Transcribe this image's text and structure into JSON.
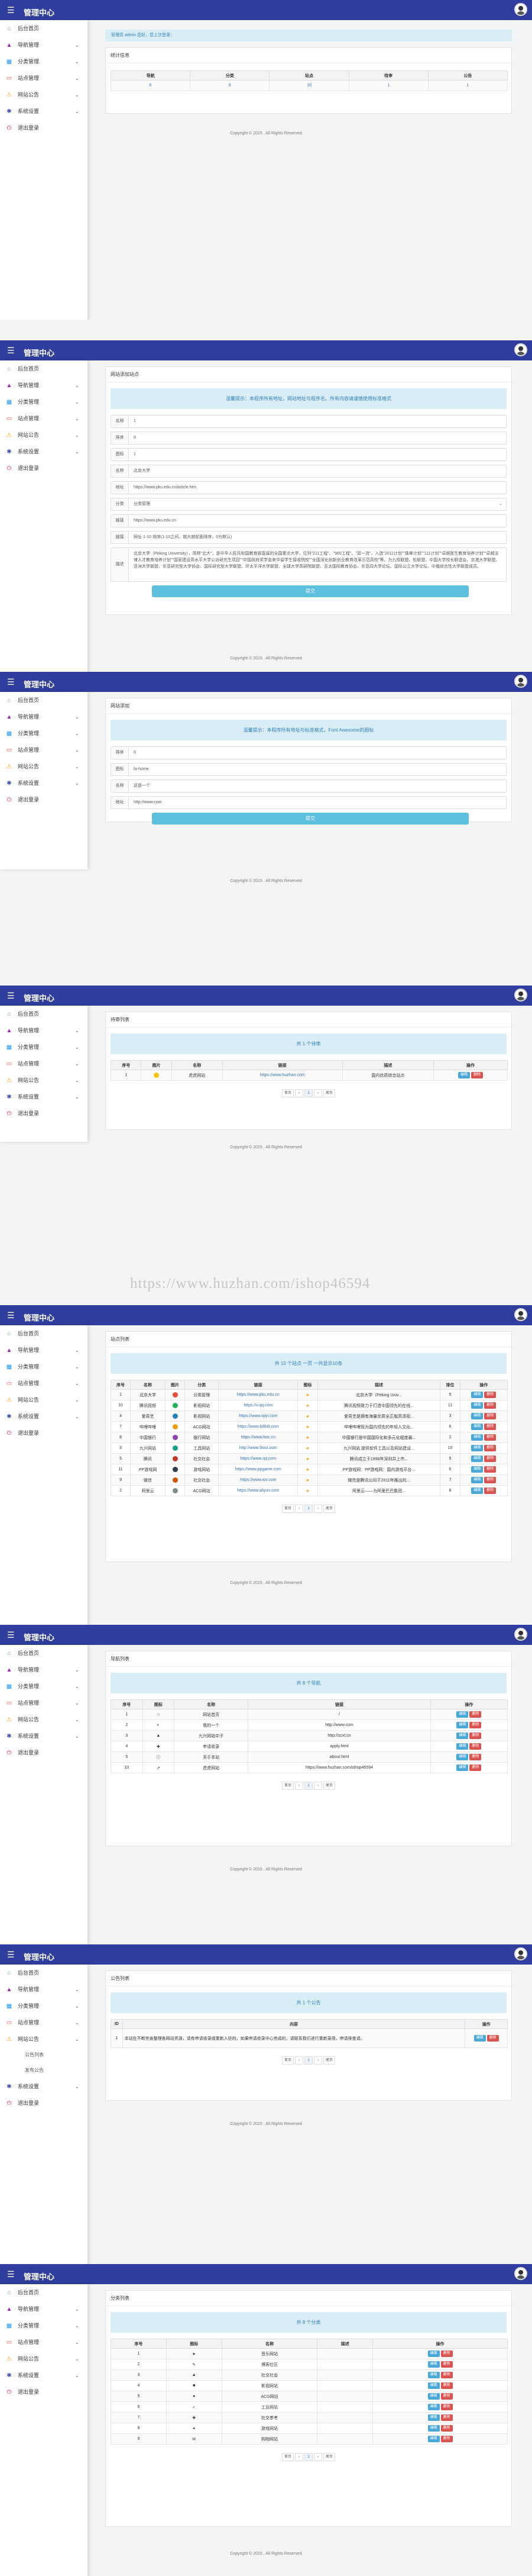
{
  "app": {
    "title": "管理中心",
    "menu_icon": "☰",
    "copyright": "Copyright © 2015 . All Rights Reserved"
  },
  "sidebar_items": [
    {
      "label": "后台首页",
      "icon": "home-icon",
      "color": "#4caf50"
    },
    {
      "label": "导航管理",
      "icon": "triangle-icon",
      "color": "#9c27b0",
      "chevron": "⌄"
    },
    {
      "label": "分类管理",
      "icon": "grid-icon",
      "color": "#2196f3",
      "chevron": "⌄"
    },
    {
      "label": "站点管理",
      "icon": "card-icon",
      "color": "#f44336",
      "chevron": "⌄"
    },
    {
      "label": "网站公告",
      "icon": "warning-icon",
      "color": "#ff9800",
      "chevron": "⌄"
    },
    {
      "label": "系统设置",
      "icon": "gear-icon",
      "color": "#3f51b5",
      "chevron": "⌄"
    },
    {
      "label": "退出登录",
      "icon": "exit-icon",
      "color": "#e91e63"
    }
  ],
  "sidebar_sub": [
    "公告列表",
    "发布公告"
  ],
  "s1": {
    "notice": "管理员 admin 您好，您上次登录：",
    "stats_title": "统计信息",
    "headers": [
      "导航",
      "分类",
      "站点",
      "待审",
      "公告"
    ],
    "values": [
      "6",
      "6",
      "10",
      "1",
      "1"
    ]
  },
  "s2": {
    "title": "网站添加站点",
    "notice": "温馨提示：本程序所有地址，网站地址与程序名。所有内容请谨慎使用标准格式",
    "rows": [
      {
        "label": "名称",
        "value": "1"
      },
      {
        "label": "排序",
        "value": "0"
      },
      {
        "label": "图标",
        "value": "1"
      },
      {
        "label": "名称",
        "value": "北京大学"
      },
      {
        "label": "地址",
        "value": "https://www.pku.edu.cn/article.htm"
      },
      {
        "label": "分类",
        "value": "分类管理",
        "arrow": "⌄"
      },
      {
        "label": "链接",
        "value": "https://www.pku.edu.cn"
      },
      {
        "label": "链接",
        "value": "网址 1-10 排序(1-10之间，越大越前面排序，0为默认)"
      }
    ],
    "description": "北京大学（Peking University），简称\"北大\"，是中华人民共和国教育部直属的全国重点大学，位列\"211工程\"、\"985工程\"、\"双一流\"，入选\"2011计划\"\"珠峰计划\"\"111计划\"\"卓越医生教育培养计划\"\"卓越法律人才教育培养计划\"\"国家建设高水平大学公派研究生项目\"\"中国政府奖学金来华留学生接收院校\"\"全国深化创新创业教育改革示范高校\"等，为九校联盟、松联盟、中国大学校长联谊会、京港大学联盟、亚洲大学联盟、东亚研究型大学协会、国际研究型大学联盟、环太平洋大学联盟、全球大学高研院联盟、亚太国际教育协会、东亚四大学论坛、国际公立大学论坛、中俄综合性大学联盟成员。",
    "submit": "提交"
  },
  "s3": {
    "title": "网站添加",
    "notice": "温馨提示：本程序所有地址与标准格式，Font Awesome的图标",
    "rows": [
      {
        "label": "排序",
        "value": "0"
      },
      {
        "label": "图标",
        "value": "fa-home"
      },
      {
        "label": "名称",
        "value": "这是一个"
      },
      {
        "label": "地址",
        "value": "http://www.com"
      }
    ],
    "submit": "提交"
  },
  "s4": {
    "title": "待审列表",
    "notice": "共 1 个待审",
    "headers": [
      "序号",
      "图片",
      "名称",
      "链接",
      "描述",
      "操作"
    ],
    "rows": [
      [
        "1",
        "",
        "虎虎网站",
        "https://www.huzhan.com",
        "国内优质综合站点"
      ]
    ],
    "pager": [
      "首页",
      "‹",
      "1",
      "›",
      "尾页"
    ]
  },
  "s5": {
    "title": "站点列表",
    "notice": "共 10 个站点 一页 一共显示10条",
    "headers": [
      "序号",
      "名称",
      "图片",
      "分类",
      "链接",
      "图标",
      "描述",
      "排位",
      "操作"
    ],
    "rows": [
      [
        "1",
        "北京大学",
        "",
        "分类管理",
        "https://www.pku.edu.cn",
        "",
        "北京大学（Peking Univ...",
        "5"
      ],
      [
        "10",
        "腾讯视频",
        "",
        "影视网站",
        "https://v.qq.com",
        "",
        "腾讯视频致力于打造中国领先的在线...",
        "11"
      ],
      [
        "4",
        "爱奇艺",
        "",
        "影视网站",
        "https://www.iqiyi.com",
        "",
        "爱奇艺是拥有海量优质全正版高清视...",
        "3"
      ],
      [
        "7",
        "哔哩哔哩",
        "",
        "ACG网站",
        "https://www.bilibili.com",
        "",
        "哔哩哔哩现为国内领先的年轻人文化...",
        "6"
      ],
      [
        "8",
        "中国银行",
        "",
        "银行网站",
        "https://www.boc.cn",
        "",
        "中国银行是中国国际化和多元化程度最...",
        "2"
      ],
      [
        "3",
        "九兴网站",
        "",
        "工具网站",
        "http://www.9xxz.com",
        "",
        "九兴网站 提供软件工具以及网站建设...",
        "10"
      ],
      [
        "5",
        "腾讯",
        "",
        "社交社会",
        "https://www.qq.com",
        "",
        "腾讯成立于1998年深圳并上市...",
        "5"
      ],
      [
        "11",
        "PP游戏网",
        "",
        "游戏网站",
        "https://www.ppgame.com",
        "",
        "PP游戏网：PP游戏网：国内游戏平台...",
        "6"
      ],
      [
        "9",
        "微信",
        "",
        "社交社会",
        "https://www.wx.com",
        "",
        "微信是腾讯公司于2011年推出的...",
        "7"
      ],
      [
        "2",
        "阿里云",
        "",
        "ACG网站",
        "https://www.aliyun.com",
        "",
        "阿里云——为阿里巴巴集团...",
        "8"
      ]
    ],
    "pager": [
      "首页",
      "‹",
      "1",
      "›",
      "尾页"
    ]
  },
  "s6": {
    "title": "导航列表",
    "notice": "共 8 个导航",
    "headers": [
      "序号",
      "图标",
      "名称",
      "链接",
      "操作"
    ],
    "rows": [
      [
        "1",
        "",
        "网站首页",
        "/"
      ],
      [
        "2",
        "",
        "我的一个",
        "http://www.com"
      ],
      [
        "3",
        "",
        "九兴网站中子",
        "http://scxt.cn"
      ],
      [
        "4",
        "",
        "申请收录",
        "apply.html"
      ],
      [
        "5",
        "",
        "关于本站",
        "about.html"
      ],
      [
        "10",
        "",
        "虎虎网站",
        "https://www.huzhan.com/ishop46594"
      ]
    ],
    "pager": [
      "首页",
      "‹",
      "1",
      "›",
      "尾页"
    ]
  },
  "s7": {
    "title": "公告列表",
    "notice": "共 1 个公告",
    "headers": [
      "ID",
      "内容",
      "操作"
    ],
    "rows": [
      [
        "1",
        "本站在不断完善整理各网站资源，请有申请收录或重新入驻的，如果申请收录中心完成的，请联系我们进行重新录用，申请排查请。"
      ]
    ],
    "pager": [
      "首页",
      "‹",
      "1",
      "›",
      "尾页"
    ]
  },
  "s8": {
    "title": "分类列表",
    "notice": "共 8 个分类",
    "headers": [
      "序号",
      "图标",
      "名称",
      "描述",
      "操作"
    ],
    "rows": [
      [
        "1",
        "",
        "音乐网站"
      ],
      [
        "2",
        "",
        "博客社区"
      ],
      [
        "3",
        "",
        "社交社会"
      ],
      [
        "4",
        "",
        "影视网站"
      ],
      [
        "5",
        "",
        "ACG网站"
      ],
      [
        "6",
        "",
        "工业网站"
      ],
      [
        "7",
        "",
        "社交参考"
      ],
      [
        "8",
        "",
        "游戏网站"
      ],
      [
        "9",
        "",
        "购物网站"
      ]
    ],
    "pager": [
      "首页",
      "‹",
      "1",
      "›",
      "尾页"
    ]
  },
  "buttons": {
    "edit": "编辑",
    "delete": "删除"
  },
  "watermark": "https://www.huzhan.com/ishop46594"
}
